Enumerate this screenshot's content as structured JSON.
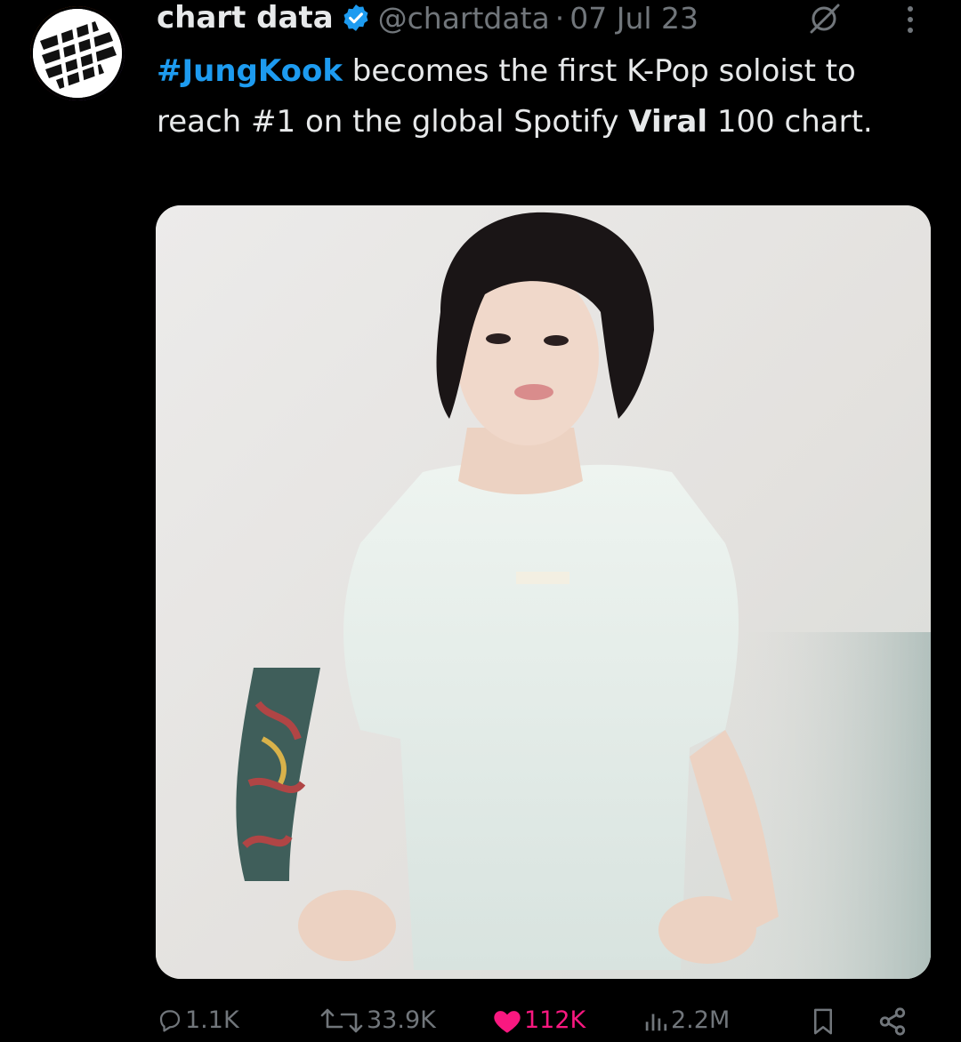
{
  "tweet": {
    "author": {
      "display_name": "chart data",
      "handle": "@chartdata",
      "verified": true,
      "avatar_icon": "chart-data-logo"
    },
    "separator": "·",
    "date": "07 Jul 23",
    "text": {
      "hashtag": "#JungKook",
      "part1": " becomes the first K-Pop soloist to reach #1 on the global Spotify ",
      "bold": "Viral",
      "part2": " 100 chart."
    },
    "media": {
      "type": "photo",
      "icon": "photo-image"
    },
    "actions": {
      "replies": "1.1K",
      "reposts": "33.9K",
      "likes": "112K",
      "views": "2.2M"
    }
  },
  "colors": {
    "background": "#000000",
    "text": "#e7e9ea",
    "muted": "#71767b",
    "link": "#1d9bf0",
    "like": "#f91880",
    "verified": "#1d9bf0"
  }
}
